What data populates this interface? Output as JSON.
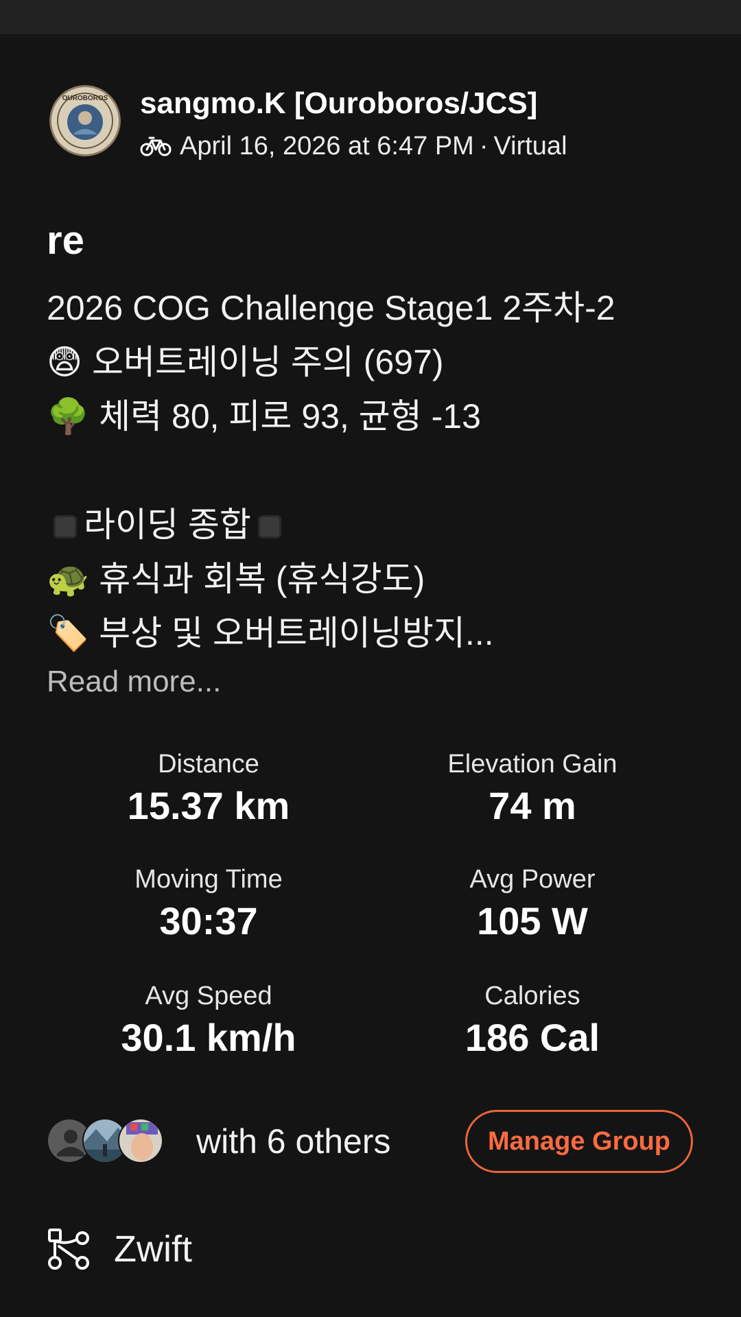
{
  "header": {
    "athlete_name": "sangmo.K [Ouroboros/JCS]",
    "activity_icon": "bike-icon",
    "datetime": "April 16, 2026 at 6:47 PM",
    "separator": "·",
    "activity_type": "Virtual",
    "avatar_text": "OUROBOROS"
  },
  "activity": {
    "title": "re",
    "description_lines": [
      "2026 COG Challenge Stage1 2주차-2",
      "😨 오버트레이닝 주의 (697)",
      "🌳 체력 80, 피로 93, 균형 -13",
      "라이딩 종합",
      "🐢 휴식과 회복 (휴식강도)",
      "🏷️ 부상 및 오버트레이닝방지..."
    ],
    "read_more": "Read more..."
  },
  "stats": [
    {
      "label": "Distance",
      "value": "15.37 km"
    },
    {
      "label": "Elevation Gain",
      "value": "74 m"
    },
    {
      "label": "Moving Time",
      "value": "30:37"
    },
    {
      "label": "Avg Power",
      "value": "105 W"
    },
    {
      "label": "Avg Speed",
      "value": "30.1 km/h"
    },
    {
      "label": "Calories",
      "value": "186 Cal"
    }
  ],
  "group": {
    "with_text": "with 6 others",
    "manage_label": "Manage Group"
  },
  "app": {
    "icon": "route-icon",
    "name": "Zwift"
  },
  "colors": {
    "background": "#141414",
    "accent": "#fc6b3f",
    "muted_text": "#bdbdbd"
  }
}
